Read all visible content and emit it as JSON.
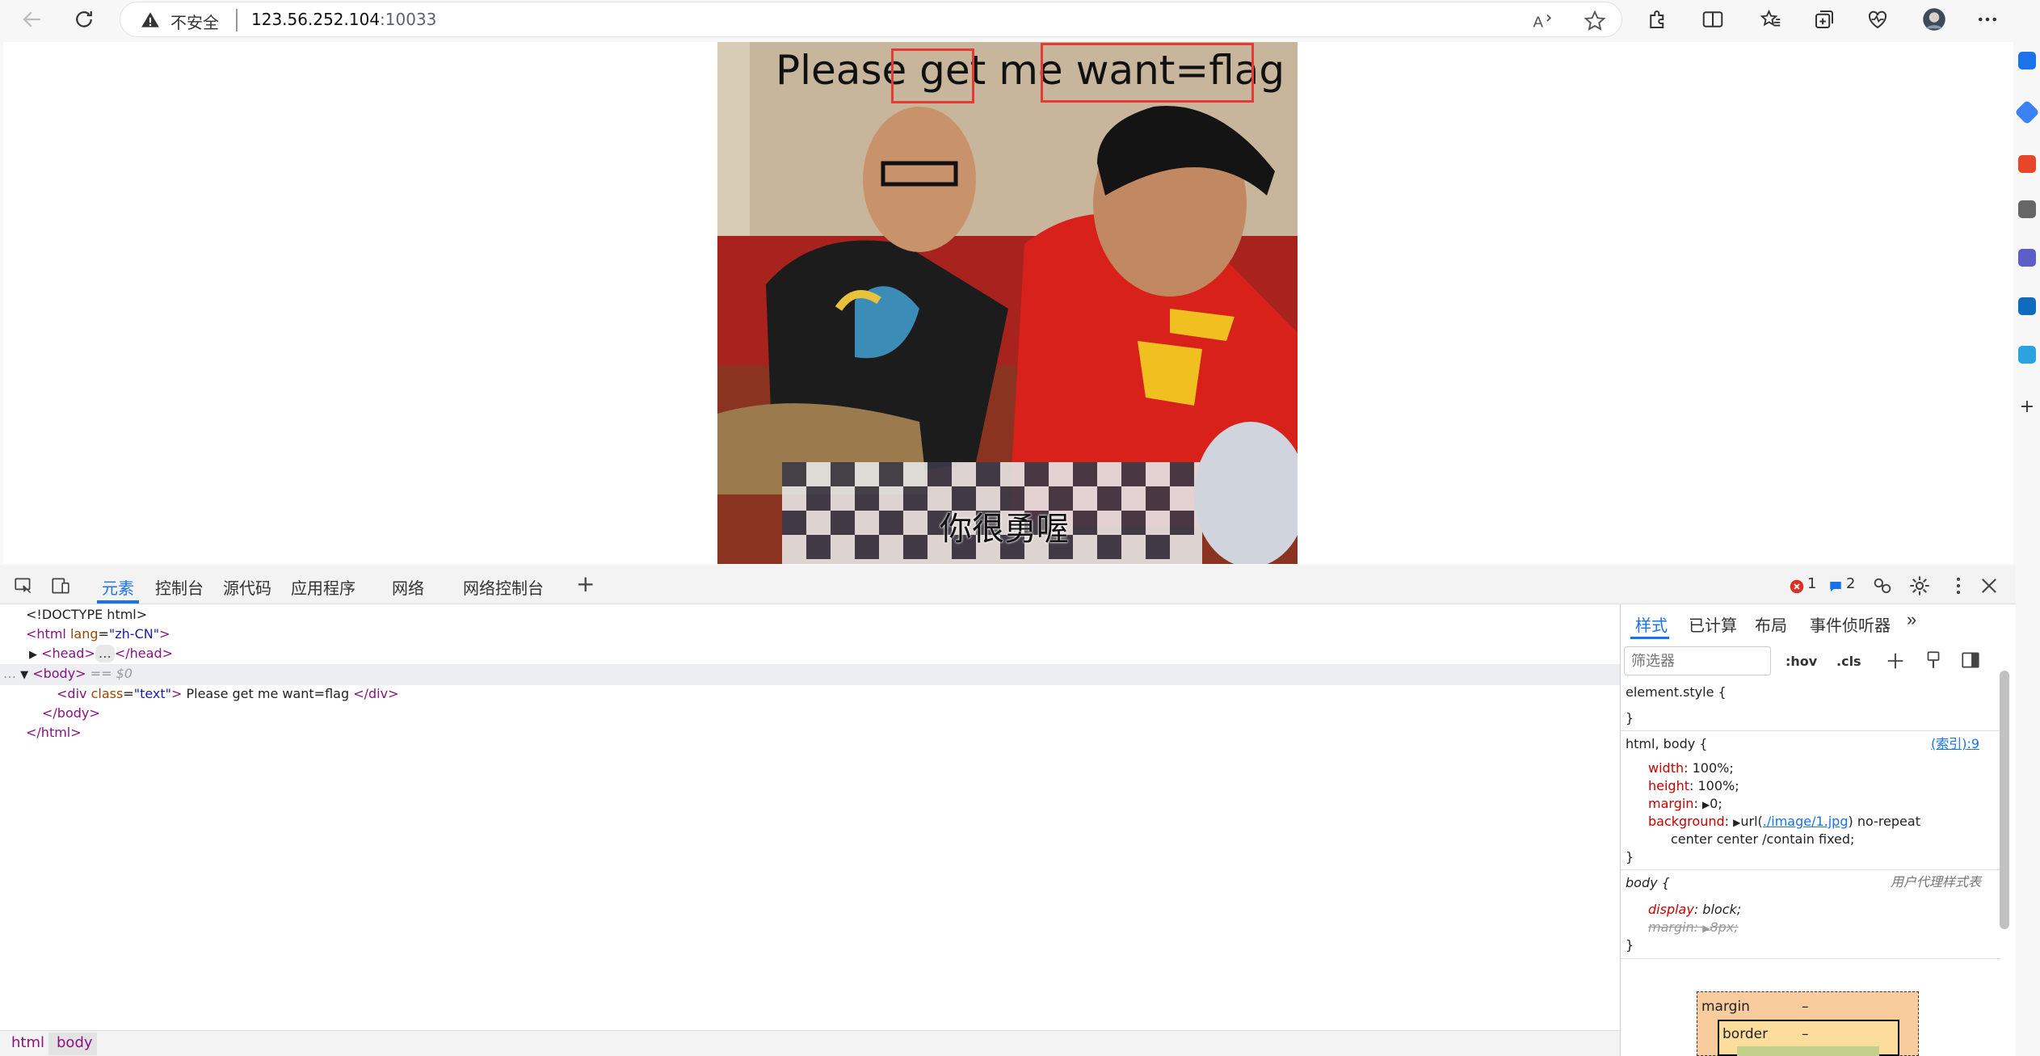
{
  "browser": {
    "security_label": "不安全",
    "url_host": "123.56.252.104",
    "url_port": ":10033"
  },
  "page": {
    "text_words": [
      "Please",
      "get",
      "me",
      "want=flag"
    ],
    "subtitle": "你很勇喔"
  },
  "devtools": {
    "tabs": [
      "元素",
      "控制台",
      "源代码",
      "应用程序",
      "网络",
      "网络控制台"
    ],
    "active_tab": "元素",
    "error_count": "1",
    "message_count": "2",
    "dom": {
      "doctype": "<!DOCTYPE html>",
      "html_open_tag": "html",
      "html_attr_name": "lang",
      "html_attr_value": "\"zh-CN\"",
      "head": "head",
      "body": "body",
      "body_marker": "== $0",
      "div_tag": "div",
      "div_attr_name": "class",
      "div_attr_value": "\"text\"",
      "div_text": " Please get me want=flag ",
      "ellipsis": "…"
    },
    "breadcrumb": [
      "html",
      "body"
    ],
    "styles_tabs": [
      "样式",
      "已计算",
      "布局",
      "事件侦听器"
    ],
    "filter_placeholder": "筛选器",
    "hov": ":hov",
    "cls": ".cls",
    "rules": {
      "element_style": "element.style {",
      "close": "}",
      "html_body_selector": "html, body {",
      "source_link": "(索引):9",
      "width_prop": "width",
      "width_val": "100%;",
      "height_prop": "height",
      "height_val": "100%;",
      "margin_prop": "margin",
      "margin_val": "0;",
      "background_prop": "background",
      "background_url_pre": "url(",
      "background_url": "./image/1.jpg",
      "background_url_post": ") no-repeat",
      "background_cont": "center center /contain fixed;",
      "body_selector": "body {",
      "ua_label": "用户代理样式表",
      "display_prop": "display",
      "display_val": "block;",
      "body_margin_prop": "margin",
      "body_margin_val": "8px;"
    },
    "boxmodel": {
      "margin_label": "margin",
      "margin_val": "–",
      "border_label": "border",
      "border_val": "–"
    }
  }
}
